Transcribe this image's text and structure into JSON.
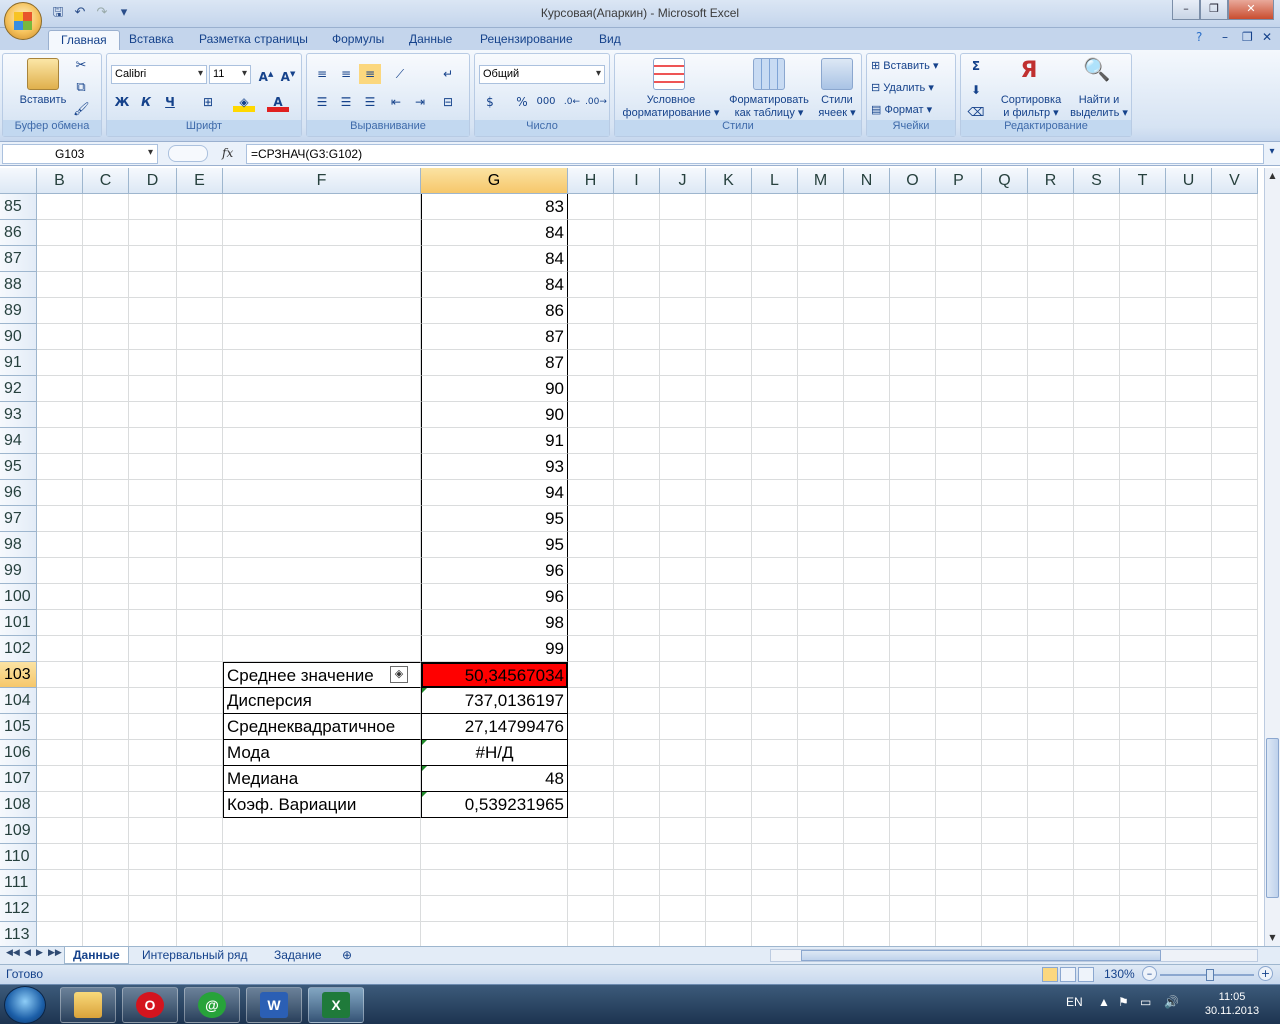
{
  "window": {
    "title": "Курсовая(Апаркин) - Microsoft Excel"
  },
  "ribbon_tabs": [
    "Главная",
    "Вставка",
    "Разметка страницы",
    "Формулы",
    "Данные",
    "Рецензирование",
    "Вид"
  ],
  "ribbon": {
    "clipboard": {
      "paste": "Вставить",
      "label": "Буфер обмена"
    },
    "font": {
      "name": "Calibri",
      "size": "11",
      "bold": "Ж",
      "italic": "К",
      "underline": "Ч",
      "label": "Шрифт"
    },
    "alignment": {
      "label": "Выравнивание"
    },
    "number": {
      "format": "Общий",
      "label": "Число",
      "percent": "%",
      "thousands": "000"
    },
    "styles": {
      "conditional": [
        "Условное",
        "форматирование"
      ],
      "as_table": [
        "Форматировать",
        "как таблицу"
      ],
      "cell_styles": [
        "Стили",
        "ячеек"
      ],
      "label": "Стили"
    },
    "cells": {
      "insert": "Вставить",
      "delete": "Удалить",
      "format": "Формат",
      "label": "Ячейки"
    },
    "editing": {
      "sort": [
        "Сортировка",
        "и фильтр"
      ],
      "find": [
        "Найти и",
        "выделить"
      ],
      "label": "Редактирование"
    }
  },
  "formula_bar": {
    "name_box": "G103",
    "fx": "fx",
    "formula": "=СРЗНАЧ(G3:G102)"
  },
  "columns": [
    "B",
    "C",
    "D",
    "E",
    "F",
    "G",
    "H",
    "I",
    "J",
    "K",
    "L",
    "M",
    "N",
    "O",
    "P",
    "Q",
    "R",
    "S",
    "T",
    "U",
    "V"
  ],
  "selected_column": "G",
  "rows": [
    {
      "n": "85",
      "G": "83"
    },
    {
      "n": "86",
      "G": "84"
    },
    {
      "n": "87",
      "G": "84"
    },
    {
      "n": "88",
      "G": "84"
    },
    {
      "n": "89",
      "G": "86"
    },
    {
      "n": "90",
      "G": "87"
    },
    {
      "n": "91",
      "G": "87"
    },
    {
      "n": "92",
      "G": "90"
    },
    {
      "n": "93",
      "G": "90"
    },
    {
      "n": "94",
      "G": "91"
    },
    {
      "n": "95",
      "G": "93"
    },
    {
      "n": "96",
      "G": "94"
    },
    {
      "n": "97",
      "G": "95"
    },
    {
      "n": "98",
      "G": "95"
    },
    {
      "n": "99",
      "G": "96"
    },
    {
      "n": "100",
      "G": "96"
    },
    {
      "n": "101",
      "G": "98"
    },
    {
      "n": "102",
      "G": "99"
    },
    {
      "n": "103",
      "F": "Среднее значение",
      "G": "50,34567034",
      "active": true
    },
    {
      "n": "104",
      "F": "Дисперсия",
      "G": "737,0136197"
    },
    {
      "n": "105",
      "F": "Среднеквадратичное",
      "G": "27,14799476"
    },
    {
      "n": "106",
      "F": "Мода",
      "G": "#Н/Д",
      "center": true
    },
    {
      "n": "107",
      "F": "Медиана",
      "G": "48"
    },
    {
      "n": "108",
      "F": "Коэф. Вариации",
      "G": "0,539231965"
    },
    {
      "n": "109"
    },
    {
      "n": "110"
    },
    {
      "n": "111"
    },
    {
      "n": "112"
    },
    {
      "n": "113"
    }
  ],
  "sheets": [
    "Данные",
    "Интервальный ряд",
    "Задание"
  ],
  "active_sheet": "Данные",
  "status": {
    "ready": "Готово",
    "zoom": "130%"
  },
  "taskbar": {
    "lang": "EN",
    "time": "11:05",
    "date": "30.11.2013"
  },
  "colors": {
    "selected_cell_fill": "#ff0000",
    "accent": "#15428b"
  }
}
